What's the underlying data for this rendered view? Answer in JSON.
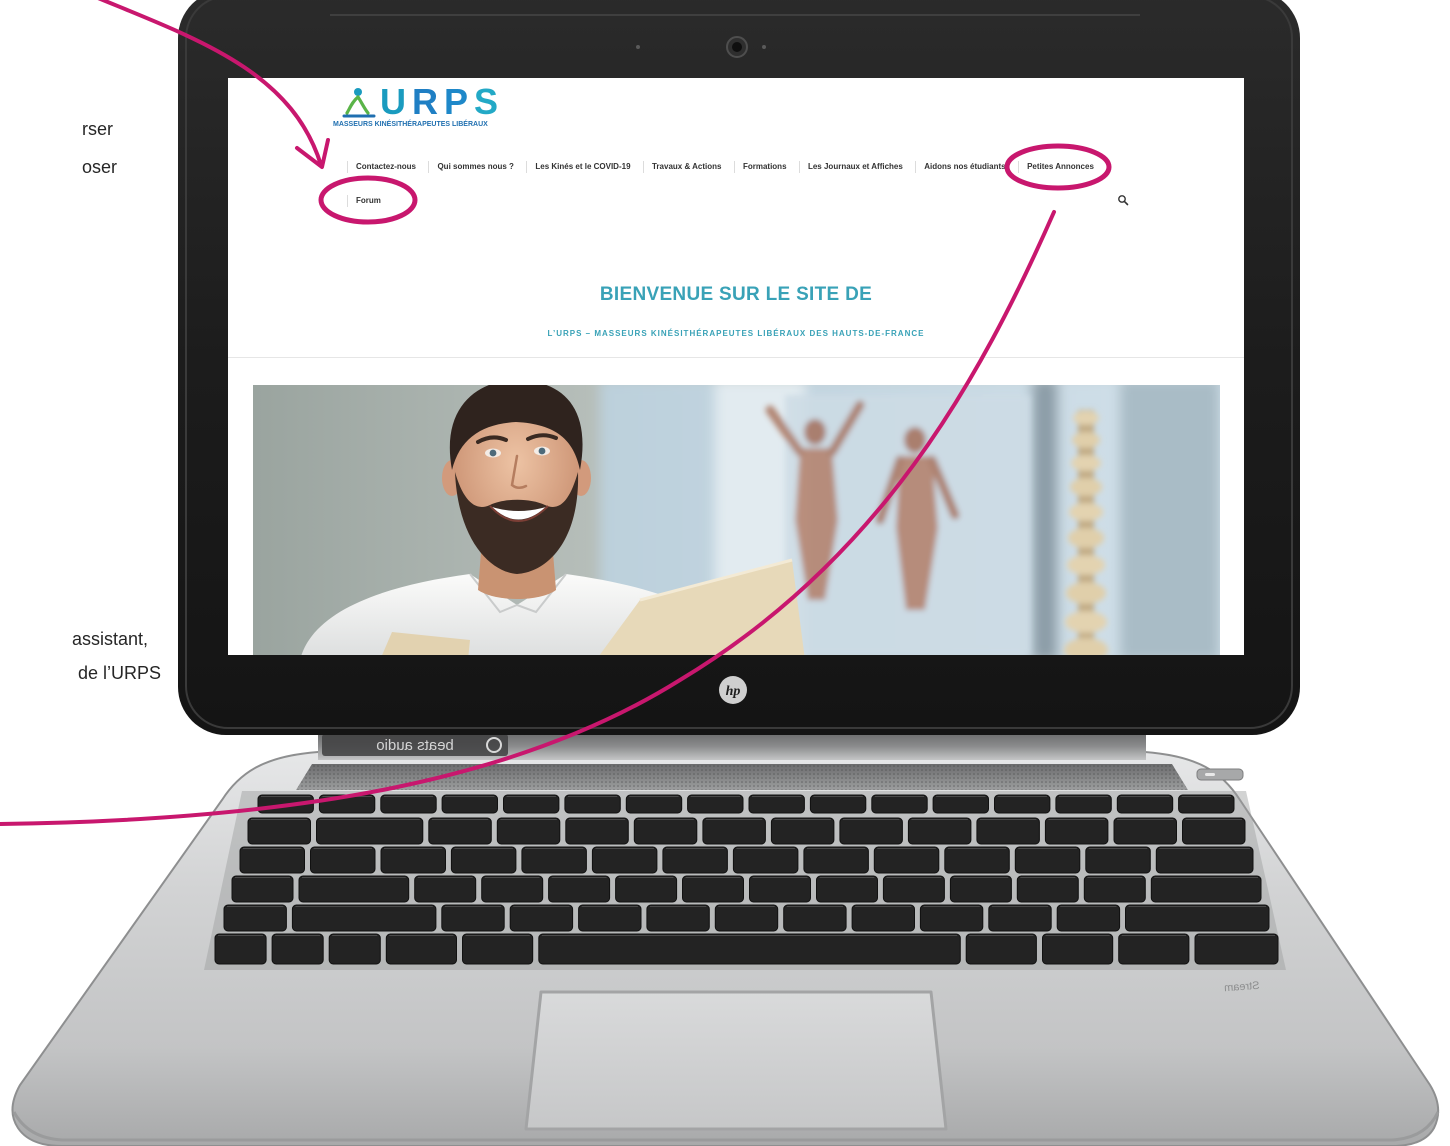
{
  "side_text": {
    "line1": "rser",
    "line2": "oser",
    "line3": "assistant,",
    "line4": "de l’URPS"
  },
  "site": {
    "logo": {
      "text": "URPS",
      "tagline": "MASSEURS KINÉSITHÉRAPEUTES LIBÉRAUX",
      "letter_colors": [
        "#1a9bbf",
        "#1f7fc4",
        "#1e88c9",
        "#23a9c6"
      ]
    },
    "nav": {
      "row1": [
        "Contactez-nous",
        "Qui sommes nous ?",
        "Les Kinés et le COVID-19",
        "Travaux & Actions",
        "Formations",
        "Les Journaux et Affiches",
        "Aidons nos étudiants",
        "Petites Annonces"
      ],
      "row2": [
        "Forum"
      ],
      "search_icon": "search-icon"
    },
    "hero": {
      "heading": "BIENVENUE SUR LE SITE DE",
      "subheading": "L’URPS – MASSEURS KINÉSITHÉRAPEUTES LIBÉRAUX DES HAUTS-DE-FRANCE"
    }
  },
  "laptop": {
    "lid_logo": "hp",
    "audio_badge": "beats audio",
    "model_badge": "Stream"
  },
  "colors": {
    "annotation": "#c8176e",
    "accent": "#39a2b7",
    "nav_text": "#333333",
    "logo_blue": "#1f6fb0",
    "bezel": "#1b1b1b",
    "key": "#232323"
  }
}
